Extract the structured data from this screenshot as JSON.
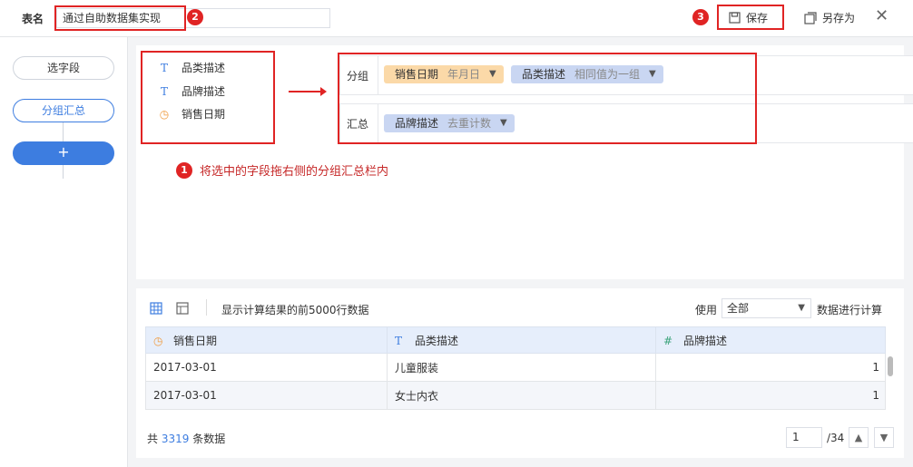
{
  "header": {
    "table_name_label": "表名",
    "table_name_value": "通过自助数据集实现",
    "badge_2": "2",
    "badge_3": "3",
    "save_label": "保存",
    "save_as_label": "另存为",
    "close_icon": "close-icon"
  },
  "steps": {
    "select_fields": "选字段",
    "group_summary": "分组汇总",
    "add": "+"
  },
  "fields": [
    {
      "icon": "text-type-icon",
      "label": "品类描述"
    },
    {
      "icon": "text-type-icon",
      "label": "品牌描述"
    },
    {
      "icon": "date-type-icon",
      "label": "销售日期"
    }
  ],
  "group_row": {
    "label": "分组",
    "chips": [
      {
        "name": "销售日期",
        "option": "年月日",
        "color": "#fbd9a8"
      },
      {
        "name": "品类描述",
        "option": "相同值为一组",
        "color": "#c9d6f2"
      }
    ]
  },
  "summary_row": {
    "label": "汇总",
    "chips": [
      {
        "name": "品牌描述",
        "option": "去重计数",
        "color": "#c9d6f2"
      }
    ]
  },
  "tip": {
    "badge": "1",
    "text": "将选中的字段拖右侧的分组汇总栏内"
  },
  "preview": {
    "notice": "显示计算结果的前5000行数据",
    "use_label": "使用",
    "use_value": "全部",
    "use_tail": "数据进行计算",
    "columns": [
      {
        "icon": "clock-icon",
        "label": "销售日期"
      },
      {
        "icon": "text-type-icon",
        "label": "品类描述"
      },
      {
        "icon": "number-type-icon",
        "label": "品牌描述"
      }
    ],
    "rows": [
      [
        "2017-03-01",
        "儿童服装",
        "1"
      ],
      [
        "2017-03-01",
        "女士内衣",
        "1"
      ]
    ],
    "total_prefix": "共",
    "total_count": "3319",
    "total_suffix": "条数据",
    "page_current": "1",
    "page_total": "/34"
  },
  "colors": {
    "accent": "#3d7de0",
    "annotation_red": "#e02424",
    "date_chip": "#fbd9a8",
    "text_chip": "#c9d6f2"
  }
}
